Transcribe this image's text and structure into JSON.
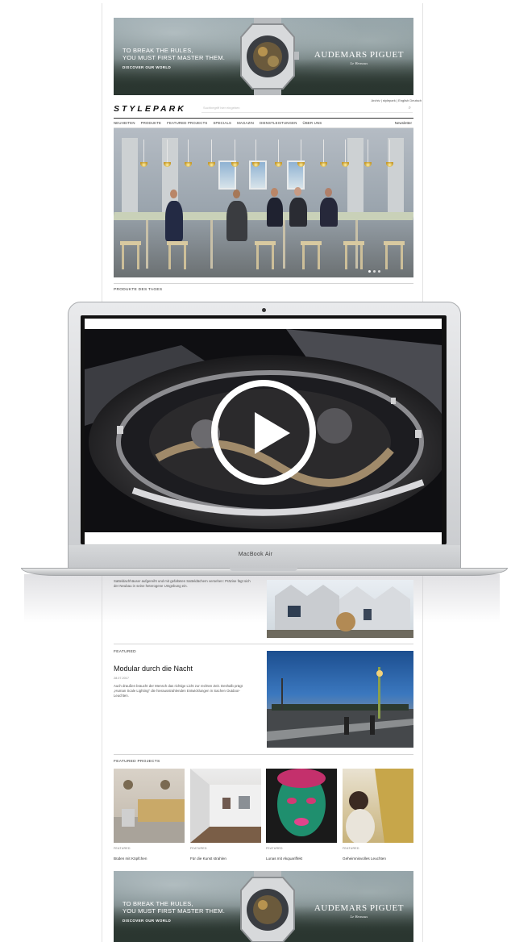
{
  "ad": {
    "tagline_1": "TO BREAK THE RULES,",
    "tagline_2": "YOU MUST FIRST MASTER THEM.",
    "cta": "DISCOVER OUR WORLD",
    "brand": "AUDEMARS PIGUET",
    "brand_sub": "Le Brassus"
  },
  "header": {
    "topnav": "Archiv  |  stylepark  |  English  Deutsch",
    "logo": "STYLEPARK",
    "search_placeholder": "Suchbegriff hier eingeben",
    "nav": [
      "NEUHEITEN",
      "PRODUKTE",
      "FEATURED PROJECTS",
      "SPECIALS",
      "MAGAZIN",
      "DIENSTLEISTUNGEN",
      "ÜBER UNS"
    ],
    "newsletter": "Newsletter"
  },
  "sections": {
    "products_of_day": "PRODUKTE DES TAGES",
    "featured": "FEATURED",
    "featured_projects": "FEATURED PROJECTS"
  },
  "laptop": {
    "label": "MacBook Air"
  },
  "article1": {
    "text": "Satteldachhäuser aufgereiht und mit gefalteten Satteldächern versehen: Präzise fügt sich der Neubau in seine heterogene Umgebung ein."
  },
  "article2": {
    "title": "Modular durch die Nacht",
    "date": "28.07.2017",
    "text": "Auch draußen braucht der Mensch das richtige Licht zur rechten Zeit. Deshalb prägt „Human Scale Lighting\" die hierausstrahlenden Entwicklungen in Sachen Outdoor-Leuchten."
  },
  "featured_projects": [
    {
      "tag": "FEATURED",
      "title": "Büden mit Köpfchen"
    },
    {
      "tag": "FEATURED",
      "title": "Für die Kunst strahlen"
    },
    {
      "tag": "FEATURED",
      "title": "Lunas mit Akquariffekt"
    },
    {
      "tag": "FEATURED",
      "title": "Geheimnisvolles Leuchten"
    }
  ],
  "colors": {
    "accent": "#1c4e8f",
    "laptop_silver": "#c9cbce"
  }
}
